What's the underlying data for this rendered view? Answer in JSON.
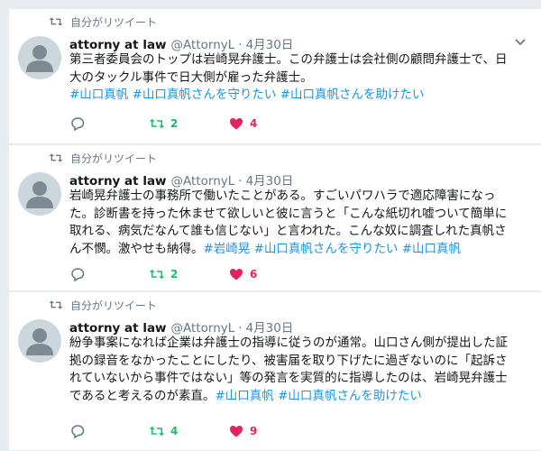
{
  "colors": {
    "retweet": "#17bf63",
    "like": "#e0245e",
    "link": "#1b95e0",
    "meta": "#657786"
  },
  "tweets": [
    {
      "rt_label": "自分がリツイート",
      "fullname": "attorny at law",
      "username": "@AttornyL",
      "dot": "·",
      "time": "4月30日",
      "lines": [
        "第三者委員会のトップは岩崎晃弁護士。この弁護士は会社側の顧問弁護士で、日",
        "大のタックル事件で日大側が雇った弁護士。"
      ],
      "hashtags": [
        "#山口真帆",
        "#山口真帆さんを守りたい",
        "#山口真帆さんを助けたい"
      ],
      "retweets": "2",
      "likes": "4"
    },
    {
      "rt_label": "自分がリツイート",
      "fullname": "attorny at law",
      "username": "@AttornyL",
      "dot": "·",
      "time": "4月30日",
      "lines": [
        "岩崎晃弁護士の事務所で働いたことがある。すごいパワハラで適応障害になっ",
        "た。診断書を持った休ませて欲しいと彼に言うと「こんな紙切れ嘘ついて簡単に",
        "取れる、病気だなんて誰も信じない」と言われた。こんな奴に調査しれた真帆さ",
        "ん不憫。激やせも納得。"
      ],
      "hashtags": [
        "#岩崎晃",
        "#山口真帆さんを守りたい",
        "#山口真帆"
      ],
      "retweets": "2",
      "likes": "6"
    },
    {
      "rt_label": "自分がリツイート",
      "fullname": "attorny at law",
      "username": "@AttornyL",
      "dot": "·",
      "time": "4月30日",
      "lines": [
        "紛争事案になれば企業は弁護士の指導に従うのが通常。山口さん側が提出した証",
        "拠の録音をなかったことにしたり、被害届を取り下げたに過ぎないのに「起訴さ",
        "れていないから事件ではない」等の発言を実質的に指導したのは、岩崎晃弁護士",
        "であると考えるのが素直。"
      ],
      "hashtags": [
        "#山口真帆",
        "#山口真帆さんを助けたい"
      ],
      "retweets": "4",
      "likes": "9"
    }
  ]
}
